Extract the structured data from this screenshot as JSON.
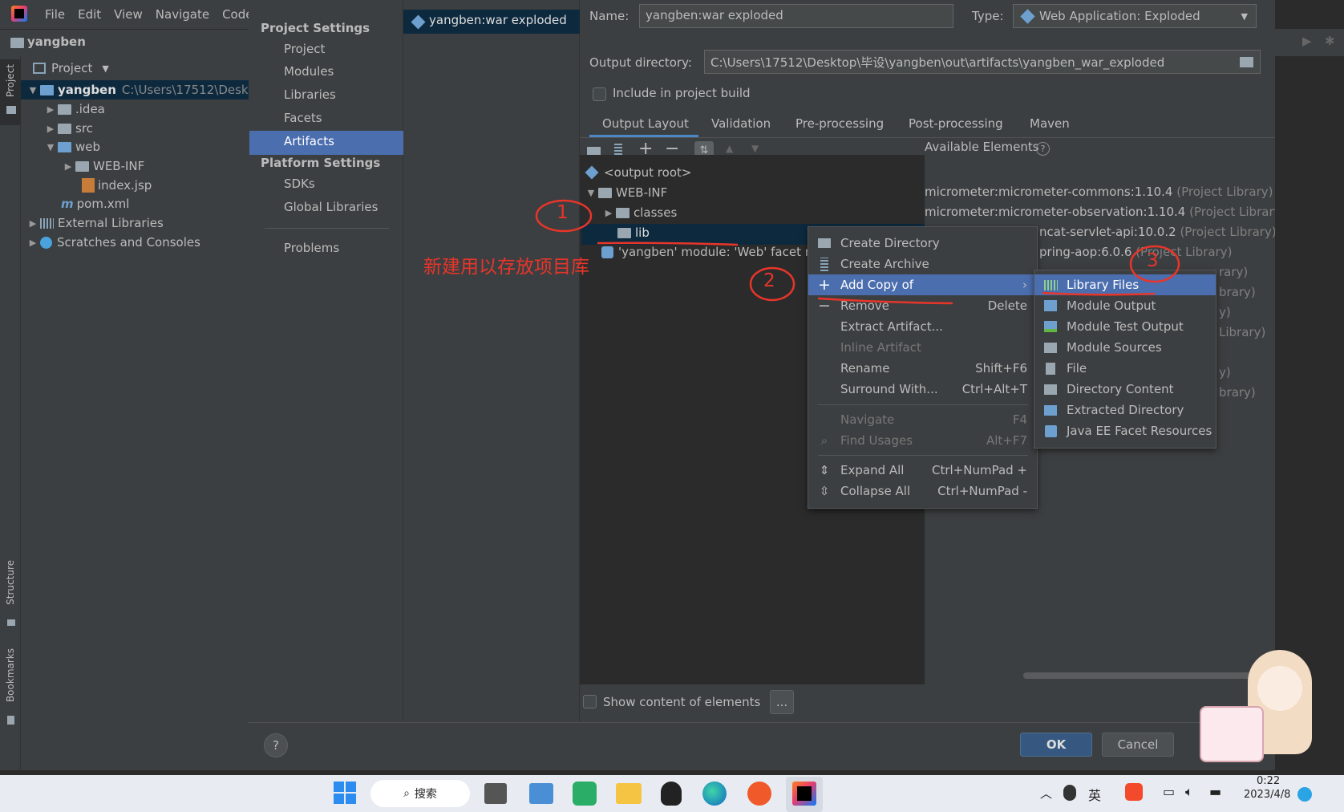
{
  "ide": {
    "menu": [
      "File",
      "Edit",
      "View",
      "Navigate",
      "Code"
    ],
    "project_name": "yangben",
    "side_tabs": {
      "project": "Project",
      "structure": "Structure",
      "bookmarks": "Bookmarks"
    },
    "project_view_label": "Project",
    "tree": {
      "root": "yangben",
      "root_path": "C:\\Users\\17512\\Deskt",
      "idea": ".idea",
      "src": "src",
      "web": "web",
      "webinf": "WEB-INF",
      "indexjsp": "index.jsp",
      "pom": "pom.xml",
      "extlibs": "External Libraries",
      "scratches": "Scratches and Consoles"
    }
  },
  "settings": {
    "project_settings_header": "Project Settings",
    "project_items": [
      "Project",
      "Modules",
      "Libraries",
      "Facets",
      "Artifacts"
    ],
    "platform_settings_header": "Platform Settings",
    "platform_items": [
      "SDKs",
      "Global Libraries"
    ],
    "problems": "Problems",
    "artifact_name": "yangben:war exploded"
  },
  "artifact": {
    "name_label": "Name:",
    "name_value": "yangben:war exploded",
    "type_label": "Type:",
    "type_value": "Web Application: Exploded",
    "output_dir_label": "Output directory:",
    "output_dir_value": "C:\\Users\\17512\\Desktop\\毕设\\yangben\\out\\artifacts\\yangben_war_exploded",
    "include_build": "Include in project build",
    "tabs": [
      "Output Layout",
      "Validation",
      "Pre-processing",
      "Post-processing",
      "Maven"
    ],
    "available_elements": "Available Elements",
    "layout": {
      "root": "<output root>",
      "webinf": "WEB-INF",
      "classes": "classes",
      "lib": "lib",
      "facet": "'yangben' module: 'Web' facet r"
    },
    "available_list": [
      {
        "name": "micrometer:micrometer-commons:1.10.4",
        "suffix": "(Project Library)"
      },
      {
        "name": "micrometer:micrometer-observation:1.10.4",
        "suffix": "(Project Library)"
      },
      {
        "name": "ncat-servlet-api:10.0.2",
        "suffix": "(Project Library)"
      },
      {
        "name": "pring-aop:6.0.6",
        "suffix": "(Project Library)"
      },
      {
        "name": "",
        "suffix": "rary)"
      },
      {
        "name": "",
        "suffix": "brary)"
      },
      {
        "name": "",
        "suffix": "y)"
      },
      {
        "name": "",
        "suffix": "Library)"
      },
      {
        "name": "",
        "suffix": "y)"
      },
      {
        "name": "",
        "suffix": "brary)"
      }
    ],
    "show_content": "Show content of elements",
    "browse_btn": "..."
  },
  "context_menu": {
    "create_directory": "Create Directory",
    "create_archive": "Create Archive",
    "add_copy_of": "Add Copy of",
    "remove": "Remove",
    "remove_sc": "Delete",
    "extract_artifact": "Extract Artifact...",
    "inline_artifact": "Inline Artifact",
    "rename": "Rename",
    "rename_sc": "Shift+F6",
    "surround": "Surround With...",
    "surround_sc": "Ctrl+Alt+T",
    "navigate": "Navigate",
    "navigate_sc": "F4",
    "find_usages": "Find Usages",
    "find_usages_sc": "Alt+F7",
    "expand_all": "Expand All",
    "expand_all_sc": "Ctrl+NumPad +",
    "collapse_all": "Collapse All",
    "collapse_all_sc": "Ctrl+NumPad -"
  },
  "submenu": [
    "Library Files",
    "Module Output",
    "Module Test Output",
    "Module Sources",
    "File",
    "Directory Content",
    "Extracted Directory",
    "Java EE Facet Resources"
  ],
  "buttons": {
    "ok": "OK",
    "cancel": "Cancel",
    "help": "?"
  },
  "annotations": {
    "note": "新建用以存放项目库",
    "one": "1",
    "two": "2",
    "three": "3"
  },
  "taskbar": {
    "search": "搜索",
    "ime": "英",
    "time": "0:22",
    "date": "2023/4/8"
  },
  "colors": {
    "accent": "#4b6eaf",
    "annotation": "#e8352a",
    "background": "#3c3f41"
  }
}
